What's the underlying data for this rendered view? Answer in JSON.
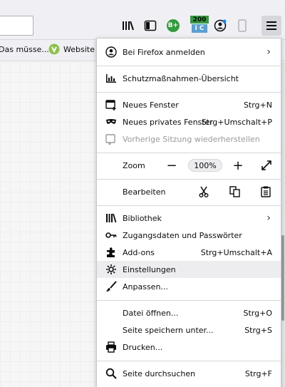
{
  "bookmarks": {
    "item1": "Das müsse...",
    "item2": "Website C"
  },
  "toolbar": {
    "counter_badge": "200",
    "counter_sub": "I C",
    "shield_letter": "B+"
  },
  "menu": {
    "signin": "Bei Firefox anmelden",
    "protections": "Schutzmaßnahmen-Übersicht",
    "new_window": "Neues Fenster",
    "new_window_sc": "Strg+N",
    "new_private": "Neues privates Fenster",
    "new_private_sc": "Strg+Umschalt+P",
    "restore": "Vorherige Sitzung wiederherstellen",
    "zoom_label": "Zoom",
    "zoom_value": "100%",
    "edit_label": "Bearbeiten",
    "library": "Bibliothek",
    "logins": "Zugangsdaten und Passwörter",
    "addons": "Add-ons",
    "addons_sc": "Strg+Umschalt+A",
    "settings": "Einstellungen",
    "customize": "Anpassen...",
    "open_file": "Datei öffnen...",
    "open_file_sc": "Strg+O",
    "save_page": "Seite speichern unter...",
    "save_page_sc": "Strg+S",
    "print": "Drucken...",
    "find": "Seite durchsuchen",
    "find_sc": "Strg+F"
  },
  "colors": {
    "badge_green": "#2e9e3a",
    "accent_blue": "#0a84ff"
  }
}
